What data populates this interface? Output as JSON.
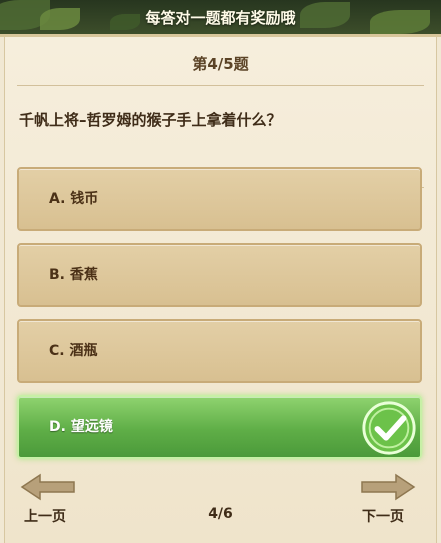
{
  "banner": {
    "title": "每答对一题都有奖励哦"
  },
  "quiz": {
    "question_number": "第4/5题",
    "question": "千帆上将–哲罗姆的猴子手上拿着什么？",
    "options": [
      {
        "label": "A. 钱币",
        "selected": false
      },
      {
        "label": "B. 香蕉",
        "selected": false
      },
      {
        "label": "C. 酒瓶",
        "selected": false
      },
      {
        "label": "D. 望远镜",
        "selected": true
      }
    ]
  },
  "nav": {
    "prev_label": "上一页",
    "next_label": "下一页",
    "page_indicator": "4/6"
  },
  "icons": {
    "correct": "checkmark-icon",
    "prev": "arrow-left-icon",
    "next": "arrow-right-icon"
  },
  "colors": {
    "correct_option": "#5fae47",
    "option_bg": "#dcc697",
    "panel_bg": "#f1e8d3",
    "text": "#4b3117"
  }
}
